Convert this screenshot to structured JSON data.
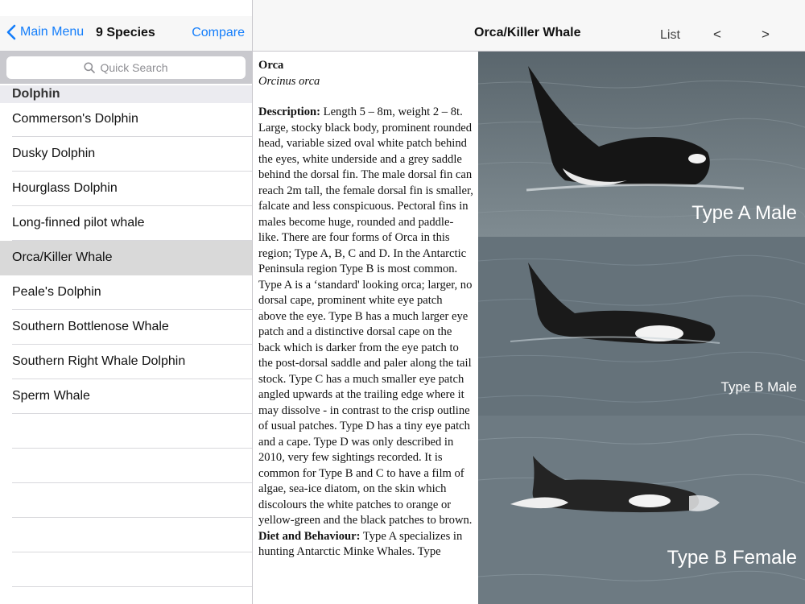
{
  "left_nav": {
    "back_label": "Main Menu",
    "count_label": "9 Species",
    "compare_label": "Compare"
  },
  "search": {
    "placeholder": "Quick Search"
  },
  "section": {
    "title": "Dolphin"
  },
  "species": [
    {
      "name": "Commerson's Dolphin"
    },
    {
      "name": "Dusky Dolphin"
    },
    {
      "name": "Hourglass Dolphin"
    },
    {
      "name": "Long-finned pilot whale"
    },
    {
      "name": "Orca/Killer Whale",
      "selected": true
    },
    {
      "name": "Peale's Dolphin"
    },
    {
      "name": "Southern Bottlenose Whale"
    },
    {
      "name": "Southern Right Whale Dolphin"
    },
    {
      "name": "Sperm Whale"
    }
  ],
  "detail_nav": {
    "title": "Orca/Killer Whale",
    "list_label": "List",
    "prev_label": "<",
    "next_label": ">"
  },
  "detail": {
    "common_name": "Orca",
    "latin_name": "Orcinus orca",
    "description_heading": "Description:",
    "description_text": " Length 5 – 8m, weight 2 – 8t. Large, stocky black body, prominent rounded head, variable sized oval white patch behind the eyes, white underside and a grey saddle behind the dorsal fin. The male dorsal fin can reach 2m tall, the female dorsal fin is smaller, falcate and less conspicuous. Pectoral fins in males become huge, rounded and paddle-like. There are four forms of Orca in this region; Type A, B, C and D. In the Antarctic Peninsula region Type B is most common. Type A is a ‘standard' looking orca; larger, no dorsal cape, prominent white eye patch above the eye. Type B has a much larger eye patch and a distinctive dorsal cape on the back which is darker from the eye patch to the post-dorsal saddle and paler along the tail stock. Type C has a much smaller eye patch angled upwards at the trailing edge where it may dissolve - in contrast to the crisp outline of usual patches. Type D has a tiny eye patch and a cape. Type D was only described in 2010, very few sightings recorded. It is common for Type B and C to have a film of algae, sea-ice diatom, on the skin which discolours the white patches to orange or yellow-green and the black patches to brown.",
    "diet_heading": "Diet and Behaviour:",
    "diet_text": " Type A specializes in hunting Antarctic Minke Whales. Type"
  },
  "photos": [
    {
      "caption": "Type A Male"
    },
    {
      "caption": "Type B Male"
    },
    {
      "caption": "Type B Female"
    }
  ]
}
